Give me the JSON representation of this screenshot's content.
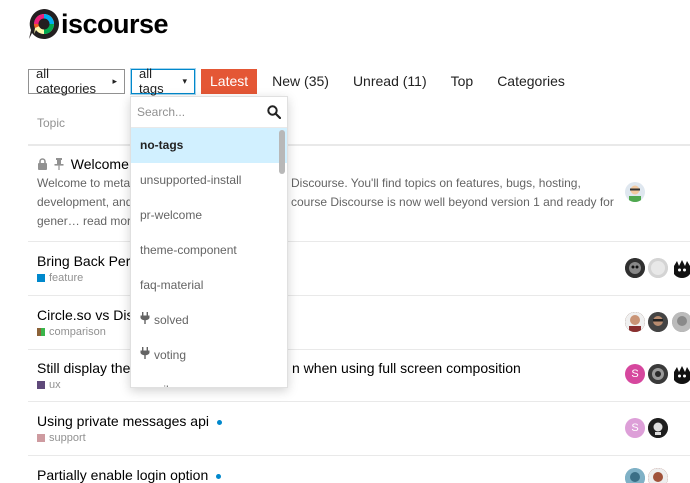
{
  "brand": {
    "name": "iscourse"
  },
  "nav": {
    "categories_select": "all categories",
    "tags_select": "all tags",
    "items": [
      {
        "label": "Latest"
      },
      {
        "label": "New (35)"
      },
      {
        "label": "Unread (11)"
      },
      {
        "label": "Top"
      },
      {
        "label": "Categories"
      }
    ]
  },
  "list": {
    "column_header": "Topic",
    "topics": [
      {
        "title": "Welcome to",
        "excerpt_line1": "Welcome to meta,",
        "excerpt_line1b": "Discourse. You'll find topics on features, bugs, hosting,",
        "excerpt_line2": "development, and",
        "excerpt_line2b": "course Discourse is now well beyond version 1 and ready for",
        "excerpt_line3": "gener… read more"
      },
      {
        "title": "Bring Back Perr",
        "category": "feature",
        "category_color": "#0088cc"
      },
      {
        "title": "Circle.so vs Dis",
        "category": "comparison",
        "category_color": "#8c6238"
      },
      {
        "title": "Still display the",
        "title_rest": "n when using full screen composition",
        "category": "ux",
        "category_color": "#5f497a"
      },
      {
        "title": "Using private messages api",
        "category": "support",
        "category_color": "#ce9ba0"
      },
      {
        "title": "Partially enable login option"
      }
    ]
  },
  "tag_dropdown": {
    "search_placeholder": "Search...",
    "options": [
      {
        "label": "no-tags"
      },
      {
        "label": "unsupported-install"
      },
      {
        "label": "pr-welcome"
      },
      {
        "label": "theme-component"
      },
      {
        "label": "faq-material"
      },
      {
        "label": "solved"
      },
      {
        "label": "voting"
      },
      {
        "label": "email"
      }
    ]
  },
  "avatars": {
    "s_letter": "S"
  }
}
